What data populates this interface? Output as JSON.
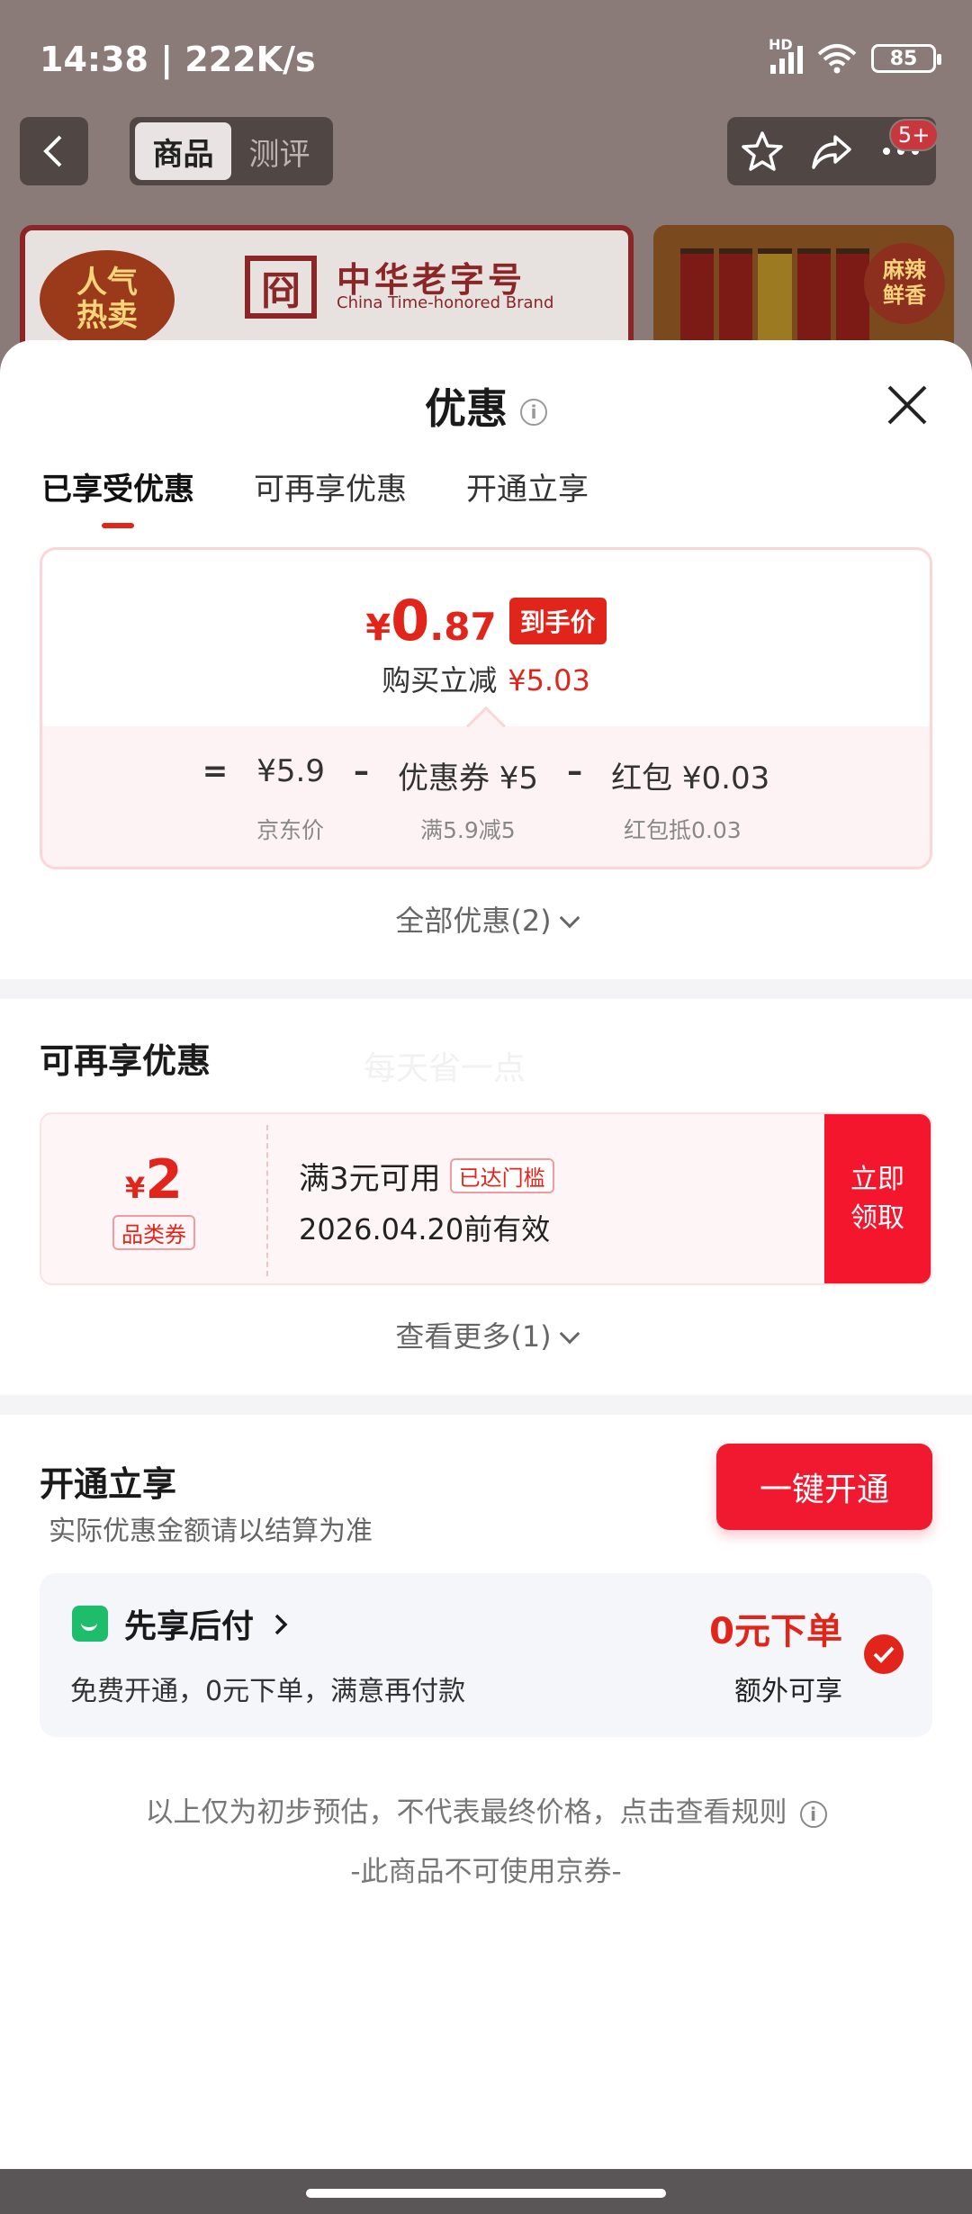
{
  "status": {
    "time": "14:38 | 222K/s",
    "network": "HD",
    "battery": "85"
  },
  "nav": {
    "tabs": [
      "商品",
      "测评"
    ],
    "badge": "5+"
  },
  "banner": {
    "hot_line1": "人气",
    "hot_line2": "热卖",
    "brand_cn": "中华老字号",
    "brand_en": "China Time-honored Brand",
    "logo_char": "冏",
    "spicy_line1": "麻辣",
    "spicy_line2": "鲜香"
  },
  "sheet": {
    "title": "优惠",
    "info_glyph": "i",
    "tabs": [
      "已享受优惠",
      "可再享优惠",
      "开通立享"
    ]
  },
  "price_card": {
    "currency": "¥",
    "final_int": "0",
    "final_dec": ".87",
    "tag": "到手价",
    "save_label": "购买立减",
    "save_amount": "¥5.03",
    "formula": [
      "=",
      "¥5.9",
      "–",
      "优惠券 ¥5",
      "–",
      "红包 ¥0.03"
    ],
    "sub_labels": [
      "京东价",
      "满5.9减5",
      "红包抵0.03"
    ]
  },
  "all_offers": "全部优惠(2)",
  "more_section": {
    "title": "可再享优惠",
    "watermark": "每天省一点",
    "coupon": {
      "currency": "¥",
      "amount": "2",
      "type": "品类券",
      "condition": "满3元可用",
      "condition_tag": "已达门槛",
      "expiry": "2026.04.20前有效",
      "button_line1": "立即",
      "button_line2": "领取"
    },
    "see_more": "查看更多(1)"
  },
  "open_section": {
    "title": "开通立享",
    "subtitle": "实际优惠金额请以结算为准",
    "button": "一键开通",
    "paylater": {
      "title": "先享后付",
      "desc": "免费开通，0元下单，满意再付款",
      "price": "0元下单",
      "extra": "额外可享"
    }
  },
  "notes": {
    "line1": "以上仅为初步预估，不代表最终价格，点击查看规则",
    "line2": "-此商品不可使用京券-"
  },
  "colors": {
    "accent": "#e1251b",
    "button": "#f0192f",
    "paylater_green": "#1dbd6b"
  }
}
